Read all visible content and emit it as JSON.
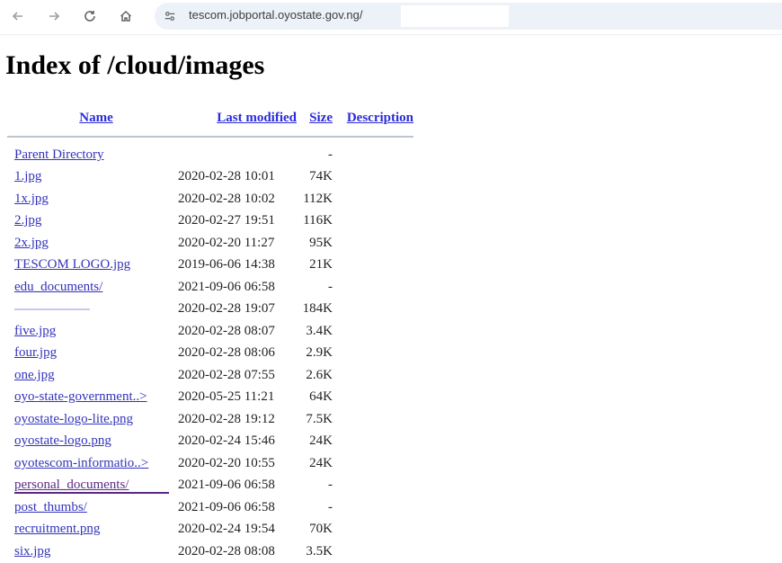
{
  "browser": {
    "url": "tescom.jobportal.oyostate.gov.ng/"
  },
  "page": {
    "title": "Index of /cloud/images",
    "columns": {
      "name": "Name",
      "last_modified": "Last modified",
      "size": "Size",
      "description": "Description"
    },
    "parent": {
      "name": "Parent Directory",
      "date": "",
      "size": "-"
    },
    "rows": [
      {
        "name": "1.jpg",
        "date": "2020-02-28 10:01",
        "size": "74K"
      },
      {
        "name": "1x.jpg",
        "date": "2020-02-28 10:02",
        "size": "112K"
      },
      {
        "name": "2.jpg",
        "date": "2020-02-27 19:51",
        "size": "116K"
      },
      {
        "name": "2x.jpg",
        "date": "2020-02-20 11:27",
        "size": "95K"
      },
      {
        "name": "TESCOM LOGO.jpg",
        "date": "2019-06-06 14:38",
        "size": "21K"
      },
      {
        "name": "edu_documents/",
        "date": "2021-09-06 06:58",
        "size": "-"
      },
      {
        "name": "",
        "date": "2020-02-28 19:07",
        "size": "184K"
      },
      {
        "name": "five.jpg",
        "date": "2020-02-28 08:07",
        "size": "3.4K"
      },
      {
        "name": "four.jpg",
        "date": "2020-02-28 08:06",
        "size": "2.9K"
      },
      {
        "name": "one.jpg",
        "date": "2020-02-28 07:55",
        "size": "2.6K"
      },
      {
        "name": "oyo-state-government..>",
        "date": "2020-05-25 11:21",
        "size": "64K"
      },
      {
        "name": "oyostate-logo-lite.png",
        "date": "2020-02-28 19:12",
        "size": "7.5K"
      },
      {
        "name": "oyostate-logo.png",
        "date": "2020-02-24 15:46",
        "size": "24K"
      },
      {
        "name": "oyotescom-informatio..>",
        "date": "2020-02-20 10:55",
        "size": "24K"
      },
      {
        "name": "personal_documents/",
        "date": "2021-09-06 06:58",
        "size": "-"
      },
      {
        "name": "post_thumbs/",
        "date": "2021-09-06 06:58",
        "size": "-"
      },
      {
        "name": "recruitment.png",
        "date": "2020-02-24 19:54",
        "size": "70K"
      },
      {
        "name": "six.jpg",
        "date": "2020-02-28 08:08",
        "size": "3.5K"
      }
    ]
  }
}
